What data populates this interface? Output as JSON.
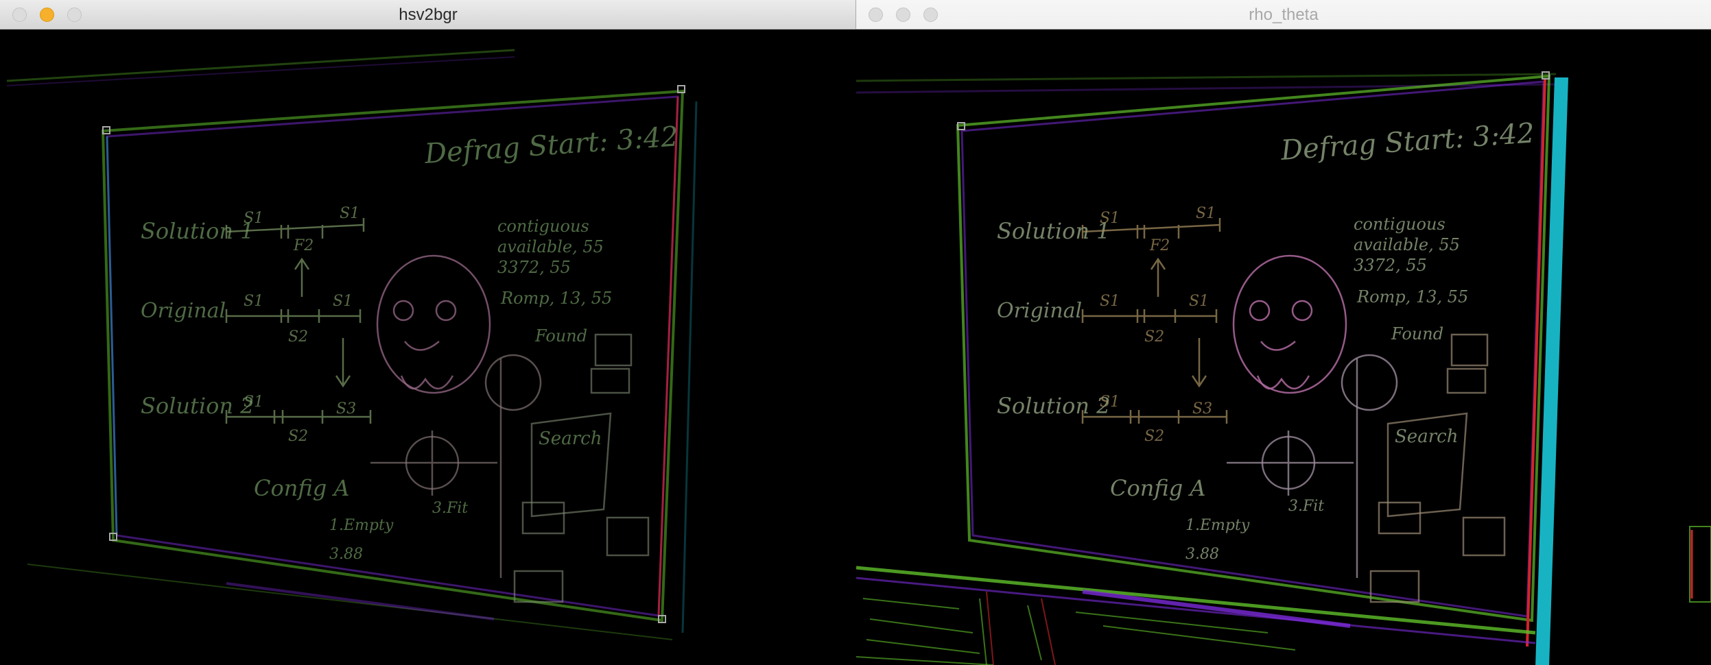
{
  "windows": [
    {
      "title": "hsv2bgr",
      "buttons": [
        "close",
        "minimize",
        "zoom"
      ]
    },
    {
      "title": "rho_theta",
      "buttons": [
        "close",
        "minimize",
        "zoom"
      ]
    }
  ],
  "whiteboard_text": {
    "top_right": "Defrag Start: 3:42",
    "row1": "Solution 1",
    "row2": "Original",
    "row3": "Solution 2",
    "config": "Config A",
    "s1": "S1",
    "s2": "S2",
    "s3": "S3",
    "f2": "F2",
    "note1": "contiguous",
    "note2": "available, 55",
    "note3": "3372, 55",
    "note4": "Romp, 13, 55",
    "found": "Found",
    "search": "Search",
    "fit": "3.Fit",
    "space_loss": "1.Empty",
    "bottom_note": "3.88"
  },
  "colors": {
    "titlebar_active": "#e6e6e6",
    "titlebar_inactive": "#f4f4f4",
    "minimize_yellow": "#f6b02c",
    "edge_purple": "#7a2bd8",
    "edge_green": "#5fbf2a",
    "edge_red": "#d2242c",
    "edge_cyan": "#17b3c3"
  }
}
